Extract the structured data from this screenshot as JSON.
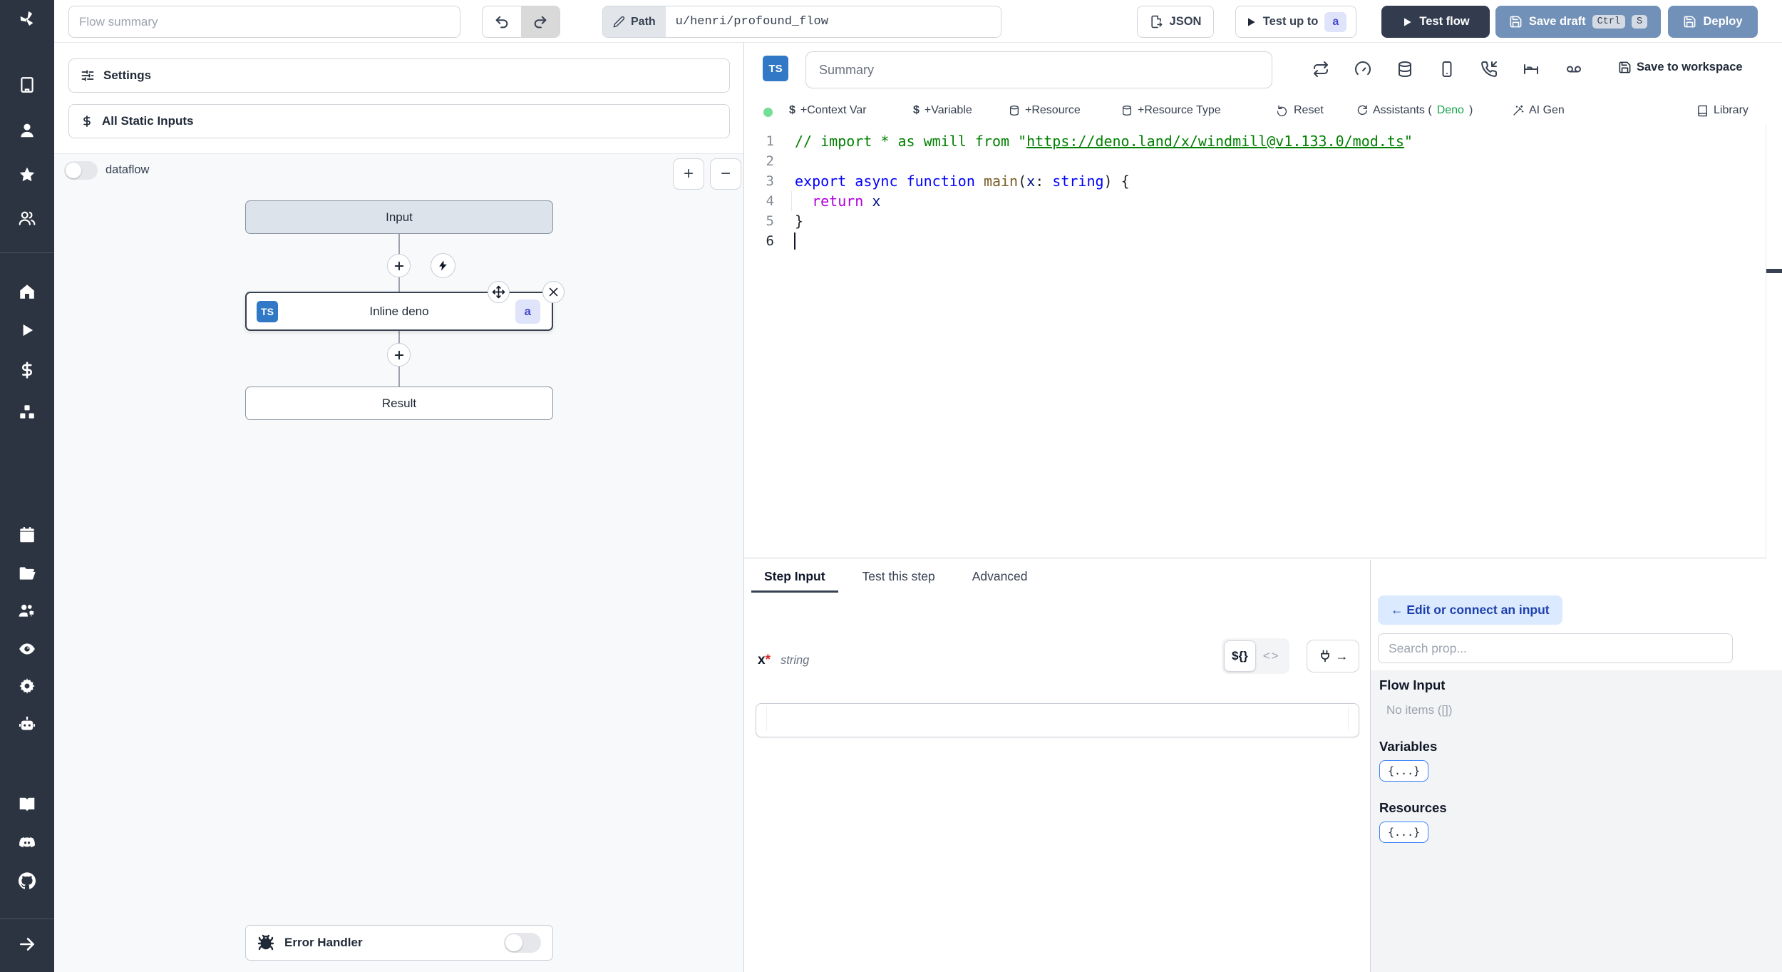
{
  "topbar": {
    "flow_summary_placeholder": "Flow summary",
    "path_label": "Path",
    "path_value": "u/henri/profound_flow",
    "json_label": "JSON",
    "test_up_to_label": "Test up to",
    "test_up_to_badge": "a",
    "test_flow_label": "Test flow",
    "save_draft_label": "Save draft",
    "save_draft_key1": "Ctrl",
    "save_draft_key2": "S",
    "deploy_label": "Deploy"
  },
  "left_panel": {
    "settings_label": "Settings",
    "static_inputs_label": "All Static Inputs",
    "dataflow_label": "dataflow",
    "zoom_in_label": "+",
    "zoom_out_label": "−",
    "input_node_label": "Input",
    "step_node_label": "Inline deno",
    "step_lang_badge": "TS",
    "step_id_badge": "a",
    "result_node_label": "Result",
    "error_handler_label": "Error Handler"
  },
  "editor": {
    "lang_badge": "TS",
    "summary_placeholder": "Summary",
    "save_to_workspace_label": "Save to workspace",
    "context_var_label": "+Context Var",
    "variable_label": "+Variable",
    "resource_label": "+Resource",
    "resource_type_label": "+Resource Type",
    "reset_label": "Reset",
    "assistants_prefix": "Assistants (",
    "assistants_lang": "Deno",
    "assistants_suffix": ")",
    "ai_gen_label": "AI Gen",
    "library_label": "Library",
    "code": {
      "active_line": 6,
      "lines": [
        [
          {
            "t": "// import * as wmill from \"",
            "c": "cmt"
          },
          {
            "t": "https://deno.land/x/windmill@v1.133.0/mod.ts",
            "c": "cmt lnk"
          },
          {
            "t": "\"",
            "c": "cmt"
          }
        ],
        [],
        [
          {
            "t": "export",
            "c": "kw"
          },
          {
            "t": " ",
            "c": "pl"
          },
          {
            "t": "async",
            "c": "kw"
          },
          {
            "t": " ",
            "c": "pl"
          },
          {
            "t": "function",
            "c": "kw"
          },
          {
            "t": " ",
            "c": "pl"
          },
          {
            "t": "main",
            "c": "fn"
          },
          {
            "t": "(",
            "c": "pl"
          },
          {
            "t": "x",
            "c": "var"
          },
          {
            "t": ": ",
            "c": "pl"
          },
          {
            "t": "string",
            "c": "kw"
          },
          {
            "t": ") {",
            "c": "pl"
          }
        ],
        [
          {
            "t": "  ",
            "c": "pl"
          },
          {
            "t": "return",
            "c": "ctl"
          },
          {
            "t": " ",
            "c": "pl"
          },
          {
            "t": "x",
            "c": "var"
          }
        ],
        [
          {
            "t": "}",
            "c": "pl"
          }
        ],
        []
      ]
    }
  },
  "step_panel": {
    "tab_step_input": "Step Input",
    "tab_test_step": "Test this step",
    "tab_advanced": "Advanced",
    "arg_name": "x",
    "required_mark": "*",
    "arg_type": "string",
    "expr_toggle_label": "${}",
    "code_toggle_label": "<>",
    "arg_value": ""
  },
  "connect_panel": {
    "edit_button_label": "← Edit or connect an input",
    "search_placeholder": "Search prop...",
    "flow_input_title": "Flow Input",
    "flow_input_empty": "No items ([])",
    "variables_title": "Variables",
    "variables_chip": "{...}",
    "resources_title": "Resources",
    "resources_chip": "{...}"
  },
  "colors": {
    "sidebar": "#2d3441",
    "accent_steel": "#7291b8",
    "accent_dark": "#333c4f",
    "ts_blue": "#3178c6",
    "deno_green": "#15a34a",
    "badge_bg": "#e0e4fb",
    "badge_fg": "#4649c8"
  }
}
